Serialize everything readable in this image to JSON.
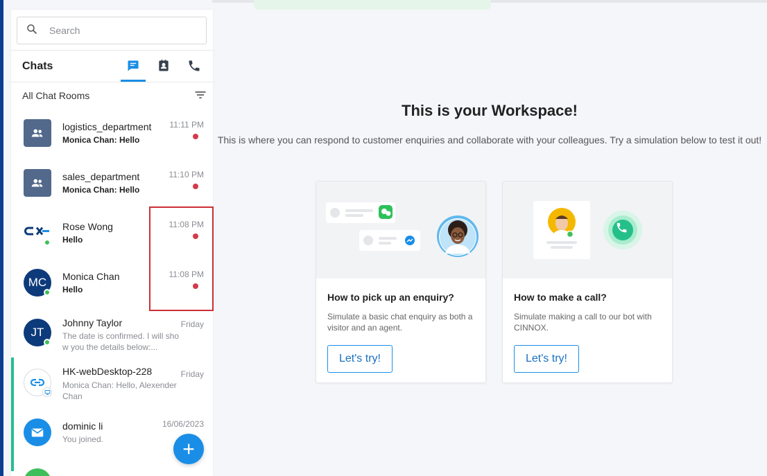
{
  "search": {
    "placeholder": "Search"
  },
  "chats_header": {
    "title": "Chats"
  },
  "filter": {
    "label": "All Chat Rooms"
  },
  "chats": [
    {
      "name": "logistics_department",
      "preview": "Monica Chan: Hello",
      "time": "11:11 PM",
      "unread": true,
      "avatar": "group-icon"
    },
    {
      "name": "sales_department",
      "preview": "Monica Chan: Hello",
      "time": "11:10 PM",
      "unread": true,
      "avatar": "group-icon"
    },
    {
      "name": "Rose Wong",
      "preview": "Hello",
      "time": "11:08 PM",
      "unread": true,
      "avatar": "cx-logo",
      "online": true
    },
    {
      "name": "Monica Chan",
      "preview": "Hello",
      "time": "11:08 PM",
      "unread": true,
      "avatar_initials": "MC",
      "online": true
    },
    {
      "name": "Johnny Taylor",
      "preview": "The date is confirmed. I will sho w you the details below:...",
      "time": "Friday",
      "unread": false,
      "avatar_initials": "JT",
      "online": true
    },
    {
      "name": "HK-webDesktop-228",
      "preview": "Monica Chan: Hello, Alexender Chan",
      "time": "Friday",
      "unread": false,
      "avatar": "link-icon"
    },
    {
      "name": "dominic li",
      "preview": "You joined.",
      "time": "16/06/2023",
      "unread": false,
      "avatar": "mail-icon"
    }
  ],
  "workspace": {
    "title": "This is your Workspace!",
    "subtitle": "This is where you can respond to customer enquiries and collaborate with your colleagues. Try a simulation below to test it out!"
  },
  "cards": [
    {
      "title": "How to pick up an enquiry?",
      "description": "Simulate a basic chat enquiry as both a visitor and an agent.",
      "button": "Let's try!"
    },
    {
      "title": "How to make a call?",
      "description": "Simulate making a call to our bot with CINNOX.",
      "button": "Let's try!"
    }
  ],
  "colors": {
    "accent": "#1a8ee6",
    "navy": "#0d3a7a",
    "unread": "#d33a4a",
    "online": "#3fbf5a",
    "highlight": "#cc2f35",
    "green_bar": "#25c08a"
  }
}
